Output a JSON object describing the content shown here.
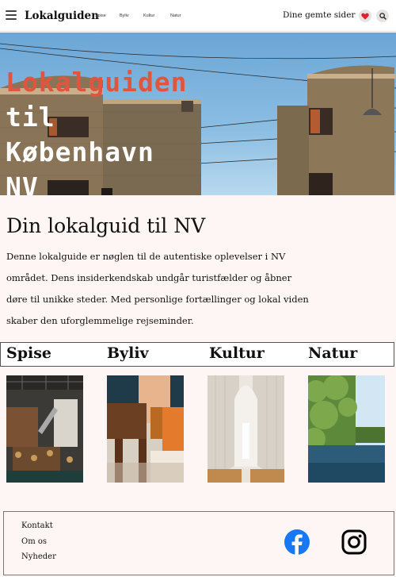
{
  "nav": {
    "brand": "Lokalguiden",
    "links": [
      "Spise",
      "Byliv",
      "Kultur",
      "Natur"
    ],
    "saved_label": "Dine gemte sider",
    "icons": [
      "menu-icon",
      "heart-icon",
      "search-icon"
    ]
  },
  "hero": {
    "title_line1": "Lokalguiden",
    "title_line2": "til",
    "title_line3": "København",
    "title_line4": "NV"
  },
  "intro": {
    "heading": "Din lokalguid til NV",
    "line1": "Denne lokalguide er nøglen til de autentiske oplevelser i NV",
    "line2": "området. Dens insiderkendskab undgår turistfælder og åbner",
    "line3": "døre til unikke steder. Med personlige fortællinger og lokal viden",
    "line4": "skaber den uforglemmelige rejseminder."
  },
  "categories": [
    {
      "label": "Spise"
    },
    {
      "label": "Byliv"
    },
    {
      "label": "Kultur"
    },
    {
      "label": "Natur"
    }
  ],
  "footer": {
    "links": [
      "Kontakt",
      "Om os",
      "Nyheder"
    ],
    "icons": [
      "facebook-icon",
      "instagram-icon"
    ]
  },
  "colors": {
    "accent": "#e1553f",
    "heart": "#e0202a",
    "facebook": "#1877f2",
    "background": "#fdf6f4"
  }
}
